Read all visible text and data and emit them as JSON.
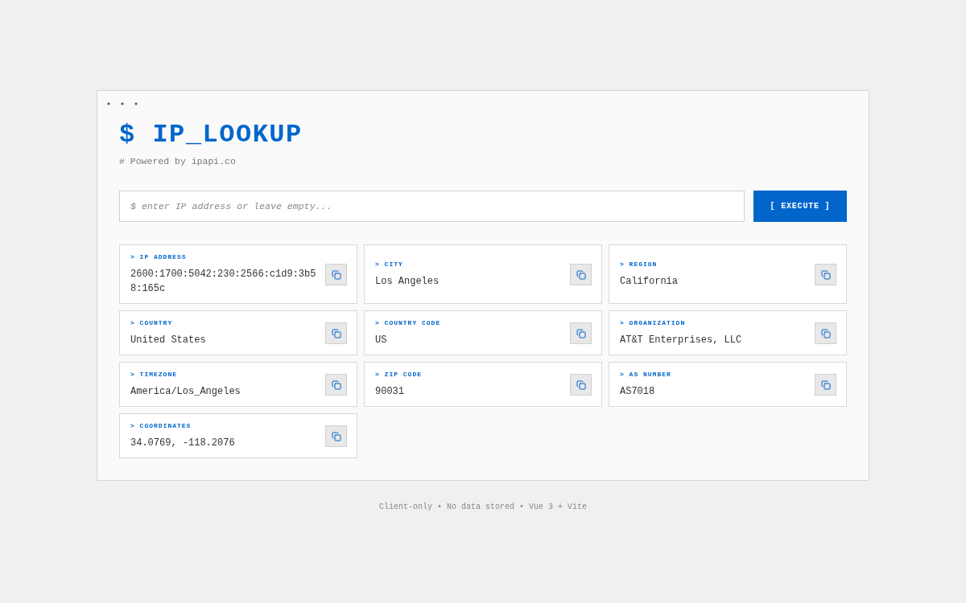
{
  "window": {
    "title": "$ IP_LOOKUP",
    "subtitle": "# Powered by ipapi.co"
  },
  "search": {
    "placeholder": "$ enter IP address or leave empty...",
    "button": "[ EXECUTE ]"
  },
  "results": [
    {
      "label": "> IP ADDRESS",
      "value": "2600:1700:5042:230:2566:c1d9:3b58:165c"
    },
    {
      "label": "> CITY",
      "value": "Los Angeles"
    },
    {
      "label": "> REGION",
      "value": "California"
    },
    {
      "label": "> COUNTRY",
      "value": "United States"
    },
    {
      "label": "> COUNTRY CODE",
      "value": "US"
    },
    {
      "label": "> ORGANIZATION",
      "value": "AT&T Enterprises, LLC"
    },
    {
      "label": "> TIMEZONE",
      "value": "America/Los_Angeles"
    },
    {
      "label": "> ZIP CODE",
      "value": "90031"
    },
    {
      "label": "> AS NUMBER",
      "value": "AS7018"
    },
    {
      "label": "> COORDINATES",
      "value": "34.0769, -118.2076"
    }
  ],
  "footer": "Client-only • No data stored • Vue 3 + Vite"
}
